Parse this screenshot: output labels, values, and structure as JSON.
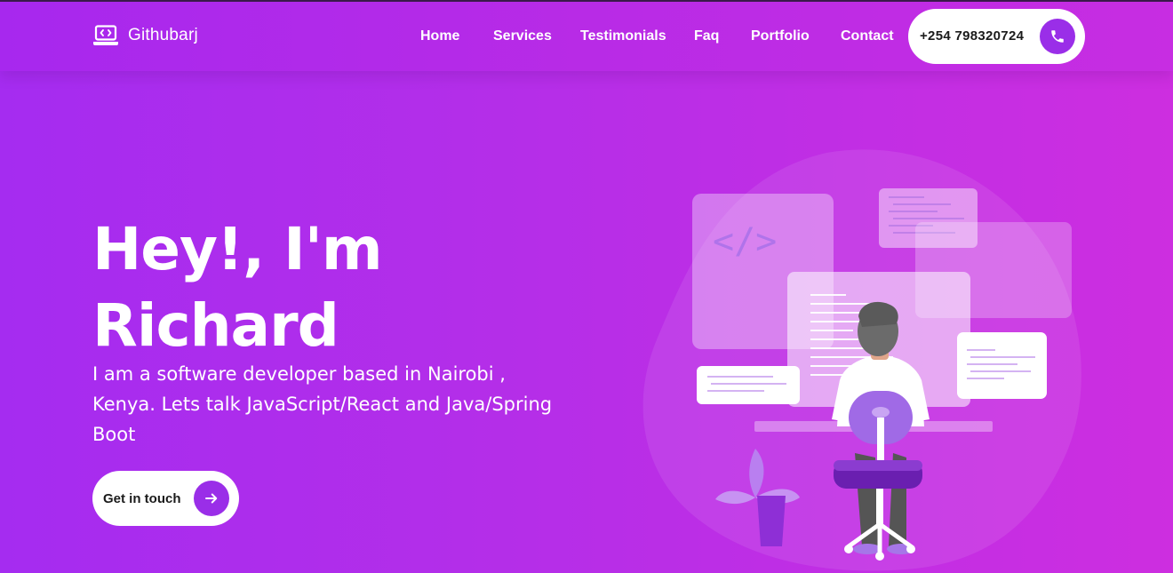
{
  "brand": {
    "name": "Githubarj",
    "icon": "laptop-code-icon"
  },
  "nav": {
    "items": [
      {
        "label": "Home"
      },
      {
        "label": "Services"
      },
      {
        "label": "Testimonials"
      },
      {
        "label": "Faq"
      },
      {
        "label": "Portfolio"
      },
      {
        "label": "Contact"
      }
    ],
    "phone": {
      "number": "+254 798320724",
      "icon": "phone-icon"
    }
  },
  "hero": {
    "title_line1": "Hey!, I'm",
    "title_line2": "Richard",
    "subtitle": "I am a software developer based in Nairobi , Kenya. Lets talk JavaScript/React and Java/Spring Boot",
    "cta_label": "Get in touch",
    "cta_icon": "arrow-right-icon",
    "code_symbol": "</>"
  },
  "colors": {
    "accent": "#9a2ee8",
    "gradient_start": "#a52cf0",
    "gradient_end": "#cd2ee0",
    "pill_bg": "#ffffff",
    "dark_text": "#1b1b1b"
  }
}
